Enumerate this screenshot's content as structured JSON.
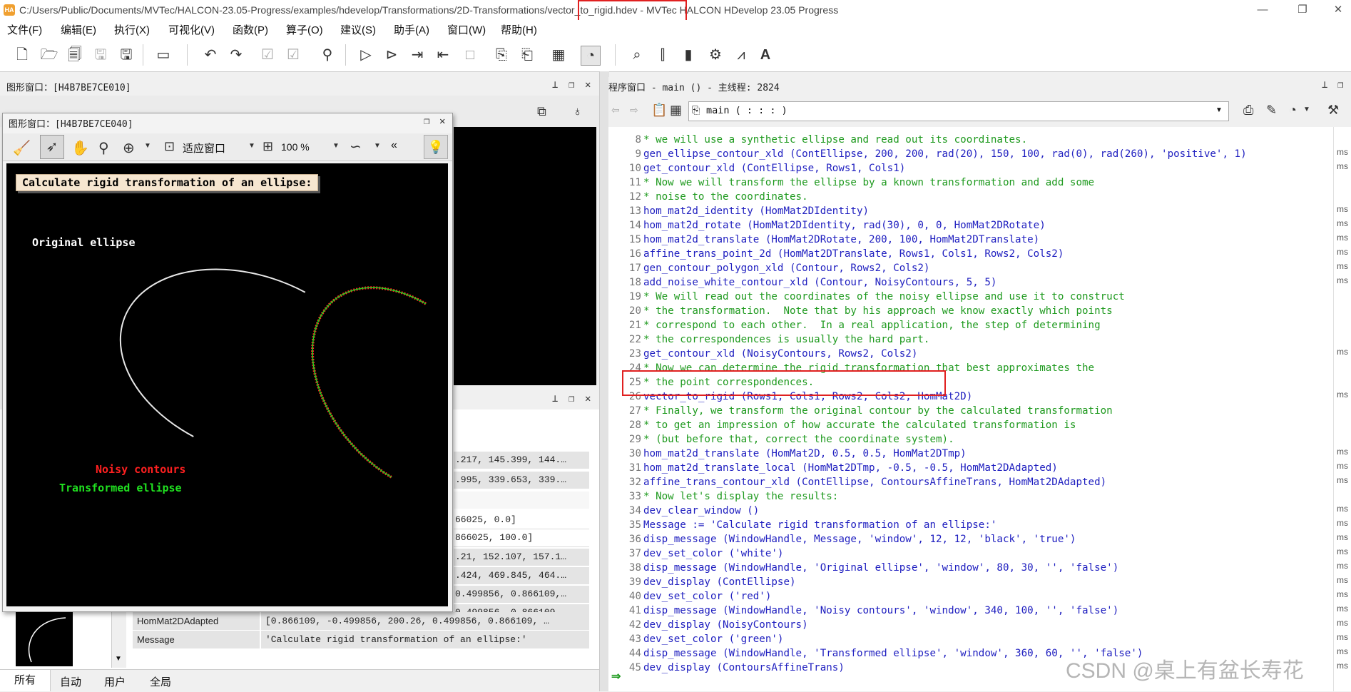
{
  "titlebar": {
    "logo": "HA",
    "path_prefix": "C:/Users/Public/Documents/MVTec/HALCON-23.05-Progress/examples/hdevelop/Transformations/2D-Transformations/",
    "file": "vector_to_rigid.hdev",
    "app": " - MVTec HALCON HDevelop 23.05 Progress",
    "minimize": "—",
    "maximize": "❐",
    "close": "✕"
  },
  "menu": [
    "文件(F)",
    "编辑(E)",
    "执行(X)",
    "可视化(V)",
    "函数(P)",
    "算子(O)",
    "建议(S)",
    "助手(A)",
    "窗口(W)",
    "帮助(H)"
  ],
  "graphics_window": {
    "title": "图形窗口：[H4B7BE7CE010]",
    "float_title": "图形窗口：[H4B7BE7CE040]",
    "fit_label": "适应窗口",
    "zoom_label": "100 %",
    "more": "«"
  },
  "canvas": {
    "message": "Calculate rigid transformation of an ellipse:",
    "original_label": "Original ellipse",
    "noisy_label": "Noisy contours",
    "transformed_label": "Transformed ellipse"
  },
  "variables": {
    "partial_rows": [
      ".217, 145.399, 144.…",
      ".995, 339.653, 339.…",
      "66025, 0.0]",
      "866025, 100.0]",
      ".21, 152.107, 157.1…",
      ".424, 469.845, 464.…",
      "0.499856, 0.866109,…",
      "0.499856, 0.866109,…"
    ],
    "rows": [
      {
        "name": "HomMat2DAdapted",
        "value": "[0.866109, -0.499856, 200.26, 0.499856, 0.866109, …"
      },
      {
        "name": "Message",
        "value": "'Calculate rigid transformation of an ellipse:'"
      }
    ],
    "tabs": [
      "所有",
      "自动",
      "用户",
      "全局"
    ]
  },
  "program_window": {
    "title": "程序窗口 - main () - 主线程: 2824",
    "procedure": "main ( : : : )"
  },
  "code": [
    {
      "n": "8",
      "t": "* we will use a synthetic ellipse and read out its coordinates.",
      "k": "cmt"
    },
    {
      "n": "9",
      "t": "gen_ellipse_contour_xld (ContEllipse, 200, 200, rad(20), 150, 100, rad(0), rad(260), 'positive', 1)",
      "k": "op"
    },
    {
      "n": "10",
      "t": "get_contour_xld (ContEllipse, Rows1, Cols1)",
      "k": "op"
    },
    {
      "n": "11",
      "t": "* Now we will transform the ellipse by a known transformation and add some",
      "k": "cmt"
    },
    {
      "n": "12",
      "t": "* noise to the coordinates.",
      "k": "cmt"
    },
    {
      "n": "13",
      "t": "hom_mat2d_identity (HomMat2DIdentity)",
      "k": "op"
    },
    {
      "n": "14",
      "t": "hom_mat2d_rotate (HomMat2DIdentity, rad(30), 0, 0, HomMat2DRotate)",
      "k": "op"
    },
    {
      "n": "15",
      "t": "hom_mat2d_translate (HomMat2DRotate, 200, 100, HomMat2DTranslate)",
      "k": "op"
    },
    {
      "n": "16",
      "t": "affine_trans_point_2d (HomMat2DTranslate, Rows1, Cols1, Rows2, Cols2)",
      "k": "op"
    },
    {
      "n": "17",
      "t": "gen_contour_polygon_xld (Contour, Rows2, Cols2)",
      "k": "op"
    },
    {
      "n": "18",
      "t": "add_noise_white_contour_xld (Contour, NoisyContours, 5, 5)",
      "k": "op"
    },
    {
      "n": "19",
      "t": "* We will read out the coordinates of the noisy ellipse and use it to construct",
      "k": "cmt"
    },
    {
      "n": "20",
      "t": "* the transformation.  Note that by his approach we know exactly which points",
      "k": "cmt"
    },
    {
      "n": "21",
      "t": "* correspond to each other.  In a real application, the step of determining",
      "k": "cmt"
    },
    {
      "n": "22",
      "t": "* the correspondences is usually the hard part.",
      "k": "cmt"
    },
    {
      "n": "23",
      "t": "get_contour_xld (NoisyContours, Rows2, Cols2)",
      "k": "op"
    },
    {
      "n": "24",
      "t": "* Now we can determine the rigid transformation that best approximates the",
      "k": "cmt"
    },
    {
      "n": "25",
      "t": "* the point correspondences.",
      "k": "cmt"
    },
    {
      "n": "26",
      "t": "vector_to_rigid (Rows1, Cols1, Rows2, Cols2, HomMat2D)",
      "k": "op"
    },
    {
      "n": "27",
      "t": "* Finally, we transform the original contour by the calculated transformation",
      "k": "cmt"
    },
    {
      "n": "28",
      "t": "* to get an impression of how accurate the calculated transformation is",
      "k": "cmt"
    },
    {
      "n": "29",
      "t": "* (but before that, correct the coordinate system).",
      "k": "cmt"
    },
    {
      "n": "30",
      "t": "hom_mat2d_translate (HomMat2D, 0.5, 0.5, HomMat2DTmp)",
      "k": "op"
    },
    {
      "n": "31",
      "t": "hom_mat2d_translate_local (HomMat2DTmp, -0.5, -0.5, HomMat2DAdapted)",
      "k": "op"
    },
    {
      "n": "32",
      "t": "affine_trans_contour_xld (ContEllipse, ContoursAffineTrans, HomMat2DAdapted)",
      "k": "op"
    },
    {
      "n": "33",
      "t": "* Now let's display the results:",
      "k": "cmt"
    },
    {
      "n": "34",
      "t": "dev_clear_window ()",
      "k": "op"
    },
    {
      "n": "35",
      "t": "Message := 'Calculate rigid transformation of an ellipse:'",
      "k": "op"
    },
    {
      "n": "36",
      "t": "disp_message (WindowHandle, Message, 'window', 12, 12, 'black', 'true')",
      "k": "op"
    },
    {
      "n": "37",
      "t": "dev_set_color ('white')",
      "k": "op"
    },
    {
      "n": "38",
      "t": "disp_message (WindowHandle, 'Original ellipse', 'window', 80, 30, '', 'false')",
      "k": "op"
    },
    {
      "n": "39",
      "t": "dev_display (ContEllipse)",
      "k": "op"
    },
    {
      "n": "40",
      "t": "dev_set_color ('red')",
      "k": "op"
    },
    {
      "n": "41",
      "t": "disp_message (WindowHandle, 'Noisy contours', 'window', 340, 100, '', 'false')",
      "k": "op"
    },
    {
      "n": "42",
      "t": "dev_display (NoisyContours)",
      "k": "op"
    },
    {
      "n": "43",
      "t": "dev_set_color ('green')",
      "k": "op"
    },
    {
      "n": "44",
      "t": "disp_message (WindowHandle, 'Transformed ellipse', 'window', 360, 60, '', 'false')",
      "k": "op"
    },
    {
      "n": "45",
      "t": "dev_display (ContoursAffineTrans)",
      "k": "op"
    }
  ],
  "ms_marks": [
    "ms",
    "ms",
    "ms",
    "ms",
    "ms",
    "ms",
    "ms",
    "ms",
    "ms",
    "ms",
    "ms",
    "ms",
    "ms",
    "ms",
    "ms",
    "ms",
    "ms",
    "ms",
    "ms",
    "ms",
    "ms",
    "ms",
    "ms",
    "ms",
    "ms"
  ],
  "watermark": "CSDN @桌上有盆长寿花",
  "colors": {
    "comment": "#1f9a1f",
    "operator": "#2020c0",
    "highlight": "#e02020",
    "noisy": "#ff2020",
    "transformed": "#20e020"
  }
}
